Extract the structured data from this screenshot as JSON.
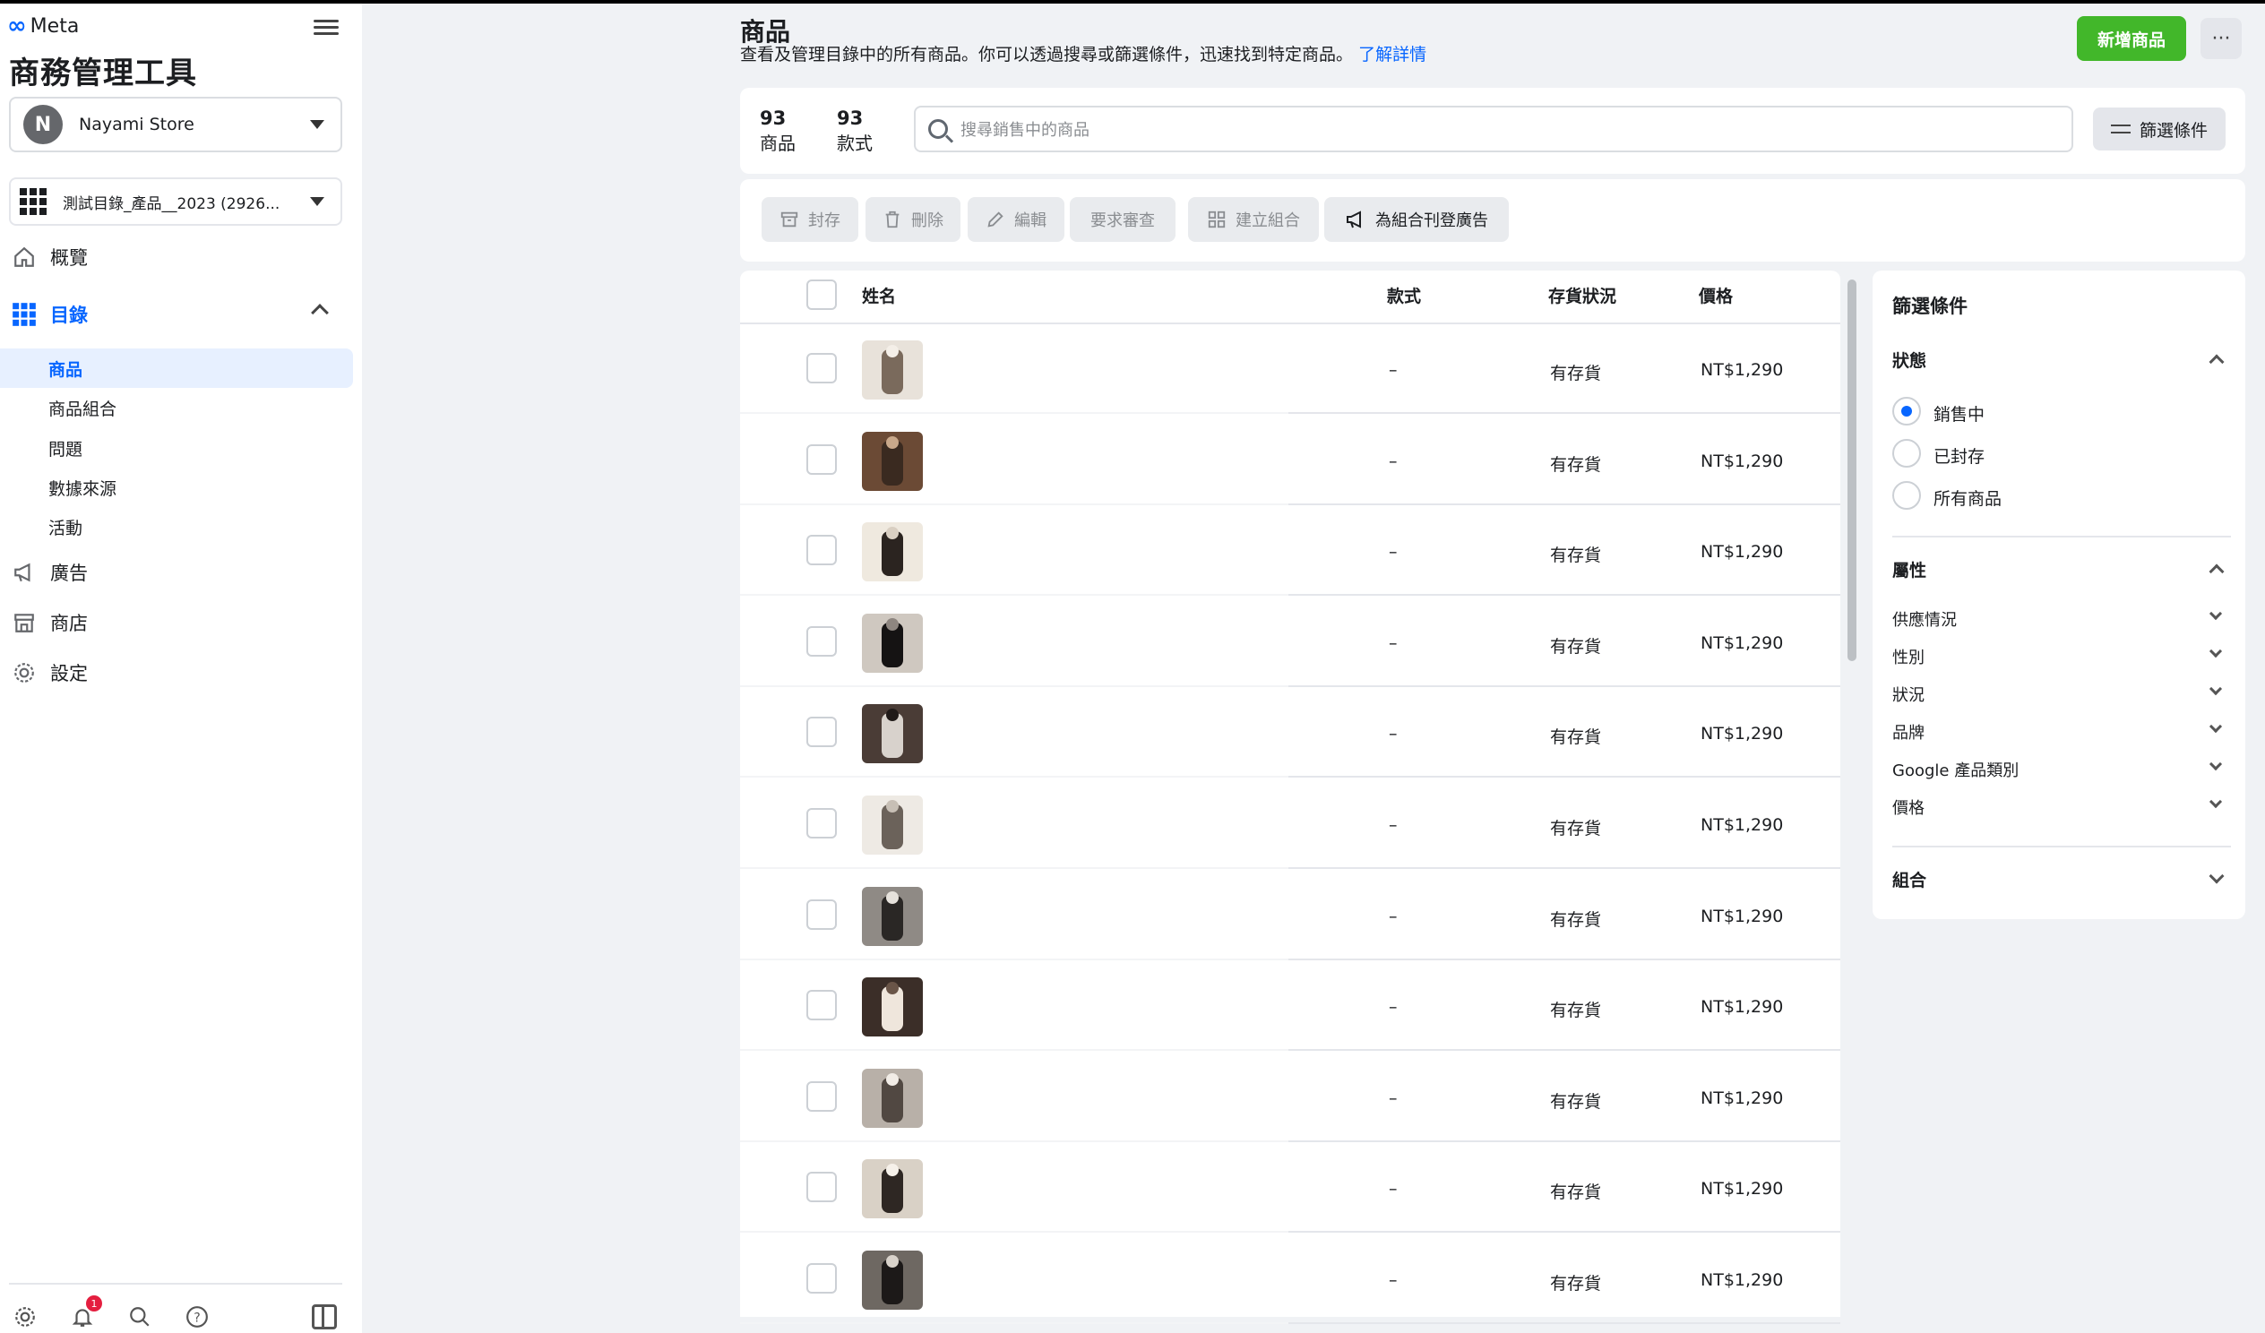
{
  "app": {
    "brand": "Meta",
    "title": "商務管理工具",
    "store": {
      "initial": "N",
      "name": "Nayami Store"
    },
    "catalog": "測試目錄_產品__2023 (2926..."
  },
  "nav": {
    "overview": "概覽",
    "catalog": "目錄",
    "sub": [
      "商品",
      "商品組合",
      "問題",
      "數據來源",
      "活動"
    ],
    "ads": "廣告",
    "shop": "商店",
    "settings": "設定"
  },
  "bottom": {
    "notification_count": "1"
  },
  "header": {
    "title": "商品",
    "subtitle": "查看及管理目錄中的所有商品。你可以透過搜尋或篩選條件，迅速找到特定商品。",
    "learn_more": "了解詳情",
    "add_button": "新增商品",
    "more": "···"
  },
  "stats": {
    "items_count": "93",
    "items_label": "商品",
    "variants_count": "93",
    "variants_label": "款式"
  },
  "search": {
    "placeholder": "搜尋銷售中的商品"
  },
  "filter_button": "篩選條件",
  "toolbar": {
    "archive": "封存",
    "delete": "刪除",
    "edit": "編輯",
    "request_review": "要求審查",
    "create_set": "建立組合",
    "advertise_set": "為組合刊登廣告"
  },
  "table": {
    "columns": {
      "name": "姓名",
      "variant": "款式",
      "stock": "存貨狀況",
      "price": "價格"
    },
    "rows": [
      {
        "variant": "–",
        "stock": "有存貨",
        "price": "NT$1,290"
      },
      {
        "variant": "–",
        "stock": "有存貨",
        "price": "NT$1,290"
      },
      {
        "variant": "–",
        "stock": "有存貨",
        "price": "NT$1,290"
      },
      {
        "variant": "–",
        "stock": "有存貨",
        "price": "NT$1,290"
      },
      {
        "variant": "–",
        "stock": "有存貨",
        "price": "NT$1,290"
      },
      {
        "variant": "–",
        "stock": "有存貨",
        "price": "NT$1,290"
      },
      {
        "variant": "–",
        "stock": "有存貨",
        "price": "NT$1,290"
      },
      {
        "variant": "–",
        "stock": "有存貨",
        "price": "NT$1,290"
      },
      {
        "variant": "–",
        "stock": "有存貨",
        "price": "NT$1,290"
      },
      {
        "variant": "–",
        "stock": "有存貨",
        "price": "NT$1,290"
      },
      {
        "variant": "–",
        "stock": "有存貨",
        "price": "NT$1,290"
      }
    ]
  },
  "filters": {
    "title": "篩選條件",
    "status": {
      "label": "狀態",
      "options": [
        "銷售中",
        "已封存",
        "所有商品"
      ],
      "selected": "銷售中"
    },
    "attributes": {
      "label": "屬性",
      "items": [
        "供應情況",
        "性別",
        "狀況",
        "品牌",
        "Google 產品類別",
        "價格"
      ]
    },
    "sets": {
      "label": "組合"
    }
  },
  "colors": {
    "accent": "#0866ff",
    "add_button": "#42b72a",
    "badge": "#e41e3f"
  }
}
